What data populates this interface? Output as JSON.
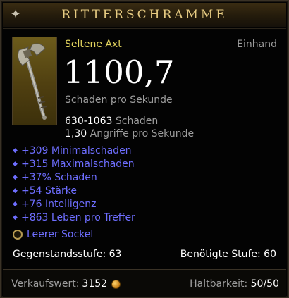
{
  "title": "RITTERSCHRAMME",
  "item": {
    "type": "Seltene Axt",
    "slot": "Einhand",
    "dps": "1100,7",
    "dps_label": "Schaden pro Sekunde",
    "damage_range": "630-1063",
    "damage_label": "Schaden",
    "speed": "1,30",
    "speed_label": "Angriffe pro Sekunde"
  },
  "affixes": [
    "+309 Minimalschaden",
    "+315 Maximalschaden",
    "+37% Schaden",
    "+54 Stärke",
    "+76 Intelligenz",
    "+863 Leben pro Treffer"
  ],
  "socket": "Leerer Sockel",
  "item_level": {
    "label": "Gegenstandsstufe:",
    "value": "63"
  },
  "required_level": {
    "label": "Benötigte Stufe:",
    "value": "60"
  },
  "sell_value": {
    "label": "Verkaufswert:",
    "value": "3152"
  },
  "durability": {
    "label": "Haltbarkeit:",
    "value": "50/50"
  },
  "icons": [
    "axe-icon",
    "gold-coin-icon",
    "socket-icon",
    "gear-icon"
  ],
  "colors": {
    "title": "#e6cb82",
    "rare": "#e2d35e",
    "magic_affix": "#6e6eff",
    "gray_text": "#9d9d9d"
  }
}
